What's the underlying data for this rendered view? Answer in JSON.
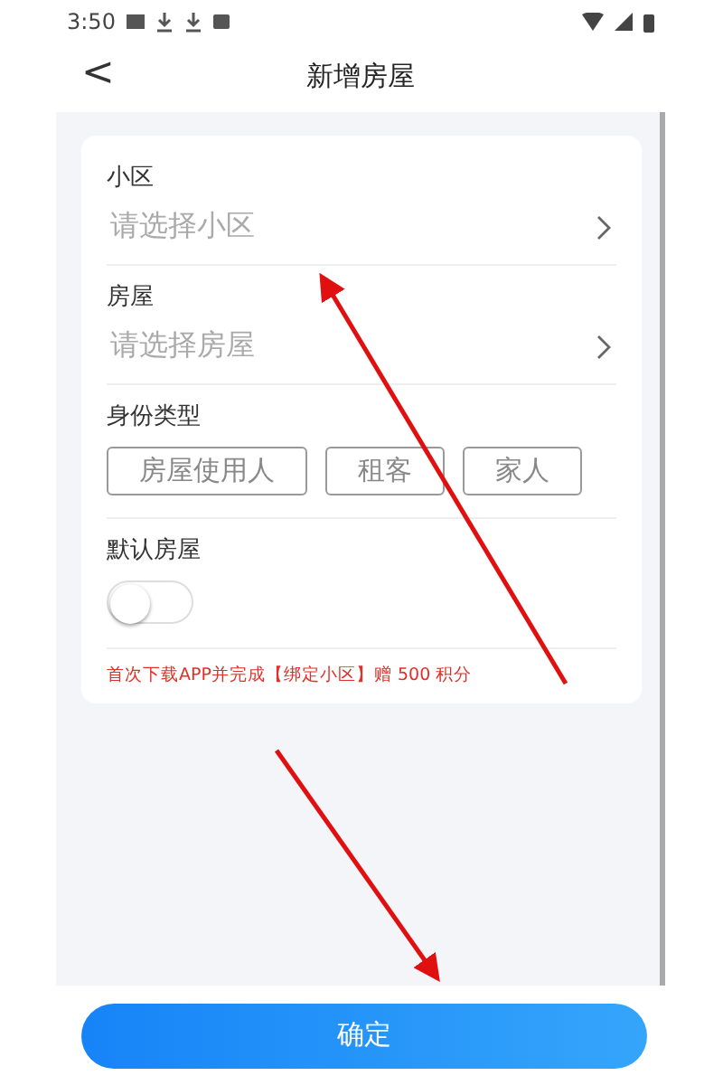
{
  "status_bar": {
    "time": "3:50"
  },
  "header": {
    "back": "<",
    "title": "新增房屋"
  },
  "form": {
    "fields": [
      {
        "kind": "select",
        "label": "小区",
        "placeholder": "请选择小区"
      },
      {
        "kind": "select",
        "label": "房屋",
        "placeholder": "请选择房屋"
      },
      {
        "kind": "options",
        "label": "身份类型",
        "options": [
          {
            "label": "房屋使用人",
            "selected": false
          },
          {
            "label": "租客",
            "selected": false
          },
          {
            "label": "家人",
            "selected": false
          }
        ]
      },
      {
        "kind": "toggle",
        "label": "默认房屋",
        "on": false
      }
    ],
    "notice": "首次下载APP并完成【绑定小区】赠 500 积分"
  },
  "confirm_button": "确定"
}
